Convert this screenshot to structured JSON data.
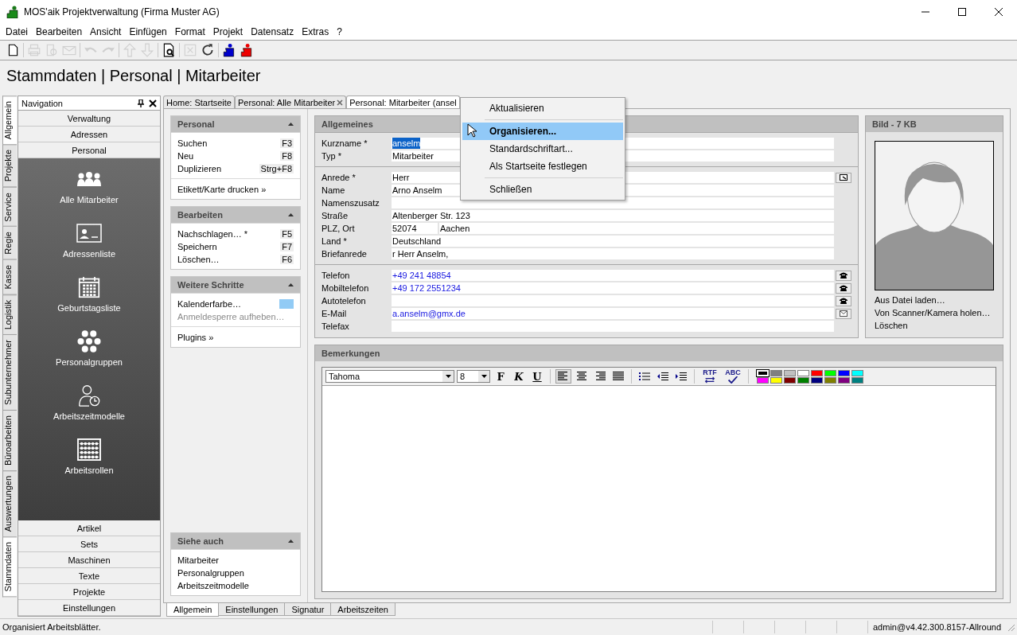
{
  "window": {
    "title": "MOS'aik Projektverwaltung (Firma Muster AG)"
  },
  "menu": [
    "Datei",
    "Bearbeiten",
    "Ansicht",
    "Einfügen",
    "Format",
    "Projekt",
    "Datensatz",
    "Extras",
    "?"
  ],
  "toolbar": [
    [
      {
        "kind": "new",
        "disabled": false
      }
    ],
    [
      {
        "kind": "print",
        "disabled": true
      },
      {
        "kind": "preview",
        "disabled": true
      },
      {
        "kind": "mail",
        "disabled": true
      }
    ],
    [
      {
        "kind": "undo",
        "disabled": true
      },
      {
        "kind": "redo",
        "disabled": true
      }
    ],
    [
      {
        "kind": "up",
        "disabled": true
      },
      {
        "kind": "down",
        "disabled": true
      }
    ],
    [
      {
        "kind": "find",
        "disabled": false
      }
    ],
    [
      {
        "kind": "table",
        "disabled": true
      },
      {
        "kind": "refresh",
        "disabled": false
      }
    ],
    [
      {
        "kind": "plugin-blue",
        "disabled": false
      },
      {
        "kind": "plugin-red",
        "disabled": false
      }
    ]
  ],
  "breadcrumb": "Stammdaten | Personal | Mitarbeiter",
  "side_tabs": [
    {
      "label": "Allgemein",
      "selected": true
    },
    {
      "label": "Projekte",
      "selected": false
    },
    {
      "label": "Service",
      "selected": false
    },
    {
      "label": "Regie",
      "selected": false
    },
    {
      "label": "Kasse",
      "selected": false
    },
    {
      "label": "Logistik",
      "selected": false
    },
    {
      "label": "Subunternehmer",
      "selected": false
    },
    {
      "label": "Büroarbeiten",
      "selected": false
    },
    {
      "label": "Auswertungen",
      "selected": false
    },
    {
      "label": "Stammdaten",
      "selected": true
    }
  ],
  "navigation": {
    "title": "Navigation",
    "groups_top": [
      "Verwaltung",
      "Adressen",
      "Personal"
    ],
    "items": [
      {
        "label": "Alle Mitarbeiter",
        "kind": "people"
      },
      {
        "label": "Adressenliste",
        "kind": "card"
      },
      {
        "label": "Geburtstagsliste",
        "kind": "calendar"
      },
      {
        "label": "Personalgruppen",
        "kind": "hexagons"
      },
      {
        "label": "Arbeitszeitmodelle",
        "kind": "person-clock"
      },
      {
        "label": "Arbeitsrollen",
        "kind": "abacus"
      }
    ],
    "groups_bottom": [
      "Artikel",
      "Sets",
      "Maschinen",
      "Texte",
      "Projekte",
      "Einstellungen"
    ]
  },
  "doc_tabs": [
    {
      "label": "Home: Startseite",
      "closable": false,
      "selected": false
    },
    {
      "label": "Personal: Alle Mitarbeiter",
      "closable": true,
      "selected": false
    },
    {
      "label": "Personal: Mitarbeiter (ansel",
      "closable": false,
      "selected": true
    }
  ],
  "tasks": [
    {
      "title": "Personal",
      "sections": [
        [
          {
            "label": "Suchen",
            "shortcut": "F3",
            "kind": "action",
            "disabled": false
          },
          {
            "label": "Neu",
            "shortcut": "F8",
            "kind": "action",
            "disabled": false
          },
          {
            "label": "Duplizieren",
            "shortcut": "Strg+F8",
            "kind": "action",
            "disabled": false
          }
        ],
        [
          {
            "label": "Etikett/Karte drucken »",
            "kind": "action",
            "disabled": false
          }
        ]
      ]
    },
    {
      "title": "Bearbeiten",
      "sections": [
        [
          {
            "label": "Nachschlagen… *",
            "shortcut": "F5",
            "kind": "action",
            "disabled": false
          },
          {
            "label": "Speichern",
            "shortcut": "F7",
            "kind": "action",
            "disabled": false
          },
          {
            "label": "Löschen…",
            "shortcut": "F6",
            "kind": "action",
            "disabled": false
          }
        ]
      ]
    },
    {
      "title": "Weitere Schritte",
      "sections": [
        [
          {
            "label": "Kalenderfarbe…",
            "kind": "color",
            "color": "#92cbf5",
            "disabled": false
          },
          {
            "label": "Anmeldesperre aufheben…",
            "kind": "action",
            "disabled": true
          }
        ],
        [
          {
            "label": "Plugins »",
            "kind": "action",
            "disabled": false
          }
        ]
      ]
    }
  ],
  "see_also": {
    "title": "Siehe auch",
    "items": [
      "Mitarbeiter",
      "Personalgruppen",
      "Arbeitszeitmodelle"
    ]
  },
  "general": {
    "title": "Allgemeines",
    "sections": [
      [
        {
          "label": "Kurzname *",
          "value": "anselm",
          "link": false,
          "text_selected": true,
          "kind": "plain"
        },
        {
          "label": "Typ *",
          "value": "Mitarbeiter",
          "link": false,
          "text_selected": false,
          "kind": "plain"
        }
      ],
      [
        {
          "label": "Anrede *",
          "value": "Herr",
          "link": false,
          "text_selected": false,
          "kind": "list"
        },
        {
          "label": "Name",
          "value": "Arno Anselm",
          "link": false,
          "text_selected": false,
          "kind": "plain"
        },
        {
          "label": "Namenszusatz",
          "kind": "plain"
        },
        {
          "label": "Straße",
          "value": "Altenberger Str. 123",
          "link": false,
          "text_selected": false,
          "kind": "plain"
        },
        {
          "label": "PLZ, Ort",
          "value": "52074",
          "value_2": "Aachen",
          "link": false,
          "text_selected": false,
          "kind": "plain"
        },
        {
          "label": "Land *",
          "value": "Deutschland",
          "link": false,
          "text_selected": false,
          "kind": "plain"
        },
        {
          "label": "Briefanrede",
          "value": "r Herr Anselm,",
          "link": false,
          "text_selected": false,
          "kind": "plain"
        }
      ],
      [
        {
          "label": "Telefon",
          "value": "+49 241 48854",
          "link": true,
          "text_selected": false,
          "kind": "phone"
        },
        {
          "label": "Mobiltelefon",
          "value": "+49 172 2551234",
          "link": true,
          "text_selected": false,
          "kind": "phone"
        },
        {
          "label": "Autotelefon",
          "kind": "phone"
        },
        {
          "label": "E-Mail",
          "value": "a.anselm@gmx.de",
          "link": true,
          "text_selected": false,
          "kind": "mail"
        },
        {
          "label": "Telefax",
          "kind": "plain"
        }
      ]
    ]
  },
  "picture_panel": {
    "title": "Bild - 7 KB",
    "actions": [
      "Aus Datei laden…",
      "Von Scanner/Kamera holen…",
      "Löschen"
    ]
  },
  "remarks": {
    "title": "Bemerkungen",
    "font": "Tahoma",
    "size": "8",
    "format_buttons": [
      {
        "label": "F",
        "kind": "bold"
      },
      {
        "label": "K",
        "kind": "italic"
      },
      {
        "label": "U",
        "kind": "underline"
      }
    ],
    "align": [
      {
        "kind": "left",
        "selected": true
      },
      {
        "kind": "center",
        "selected": false
      },
      {
        "kind": "right",
        "selected": false
      },
      {
        "kind": "justify",
        "selected": false
      }
    ],
    "rtf_label": "RTF",
    "spell_label": "ABC",
    "palette": [
      {
        "color": "#000000",
        "selected": true
      },
      {
        "color": "#808080",
        "selected": false
      },
      {
        "color": "#c0c0c0",
        "selected": false
      },
      {
        "color": "#ffffff",
        "selected": false
      },
      {
        "color": "#ff0000",
        "selected": false
      },
      {
        "color": "#00ff00",
        "selected": false
      },
      {
        "color": "#0000ff",
        "selected": false
      },
      {
        "color": "#00ffff",
        "selected": false
      },
      {
        "color": "#ff00ff",
        "selected": false
      },
      {
        "color": "#ffff00",
        "selected": false
      },
      {
        "color": "#800000",
        "selected": false
      },
      {
        "color": "#008000",
        "selected": false
      },
      {
        "color": "#000080",
        "selected": false
      },
      {
        "color": "#808000",
        "selected": false
      },
      {
        "color": "#800080",
        "selected": false
      },
      {
        "color": "#008080",
        "selected": false
      }
    ]
  },
  "form_tabs": [
    {
      "label": "Allgemein",
      "selected": true
    },
    {
      "label": "Einstellungen",
      "selected": false
    },
    {
      "label": "Signatur",
      "selected": false
    },
    {
      "label": "Arbeitszeiten",
      "selected": false
    }
  ],
  "status_bar": {
    "message": "Organisiert Arbeitsblätter.",
    "user": "admin@v4.42.300.8157-Allround"
  },
  "context_menu": {
    "sections": [
      [
        {
          "label": "Aktualisieren",
          "selected": false
        }
      ],
      [
        {
          "label": "Organisieren...",
          "selected": true
        },
        {
          "label": "Standardschriftart...",
          "selected": false
        },
        {
          "label": "Als Startseite festlegen",
          "selected": false
        }
      ],
      [
        {
          "label": "Schließen",
          "selected": false
        }
      ]
    ]
  }
}
